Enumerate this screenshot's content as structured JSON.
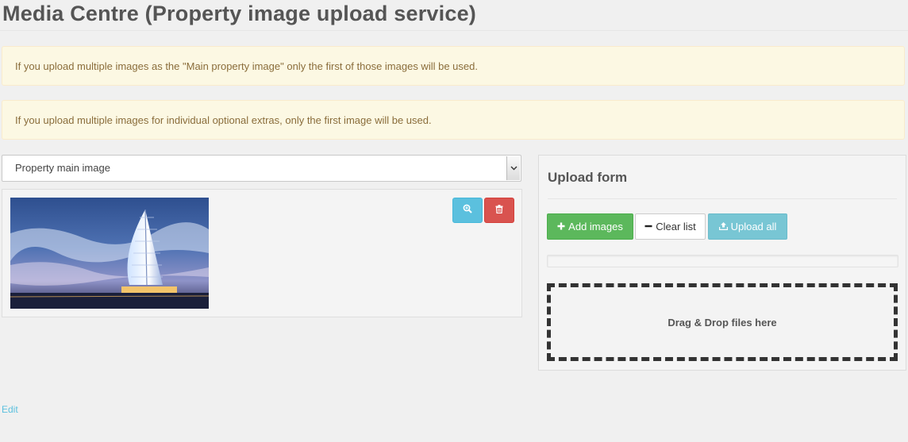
{
  "page": {
    "title": "Media Centre (Property image upload service)"
  },
  "alerts": [
    "If you upload multiple images as the \"Main property image\" only the first of those images will be used.",
    "If you upload multiple images for individual optional extras, only the first image will be used."
  ],
  "image_type_select": {
    "selected": "Property main image"
  },
  "image_list": {
    "items": [
      {
        "image_icon": "hotel-tower-photo",
        "zoom_icon": "zoom-in-icon",
        "delete_icon": "trash-icon"
      }
    ]
  },
  "upload_form": {
    "title": "Upload form",
    "add_label": "Add images",
    "clear_label": "Clear list",
    "upload_label": "Upload all",
    "dropzone_text": "Drag & Drop files here"
  },
  "footer": {
    "edit_label": "Edit"
  },
  "colors": {
    "alert_bg": "#fcf8e3",
    "alert_text": "#8a6d3b",
    "success": "#5cb85c",
    "info": "#5bc0de",
    "danger": "#d9534f"
  }
}
